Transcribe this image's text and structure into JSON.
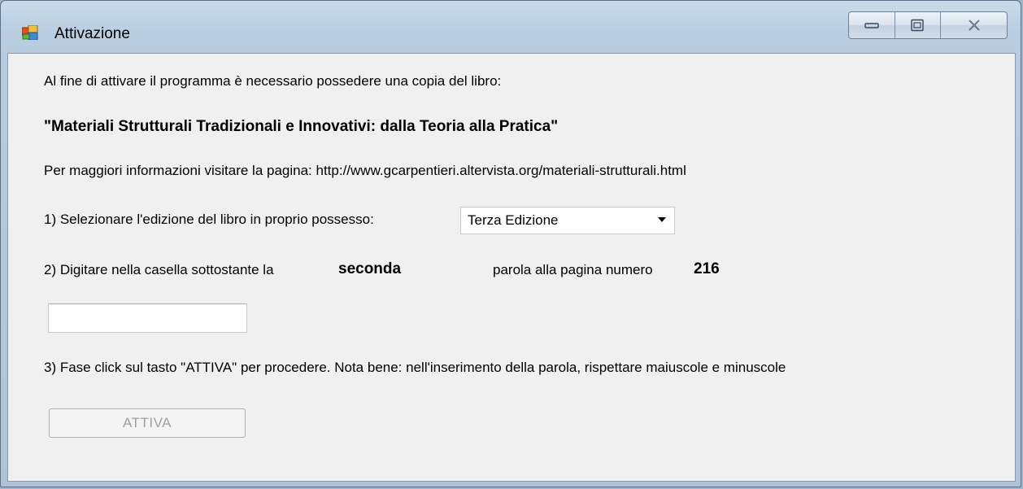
{
  "window": {
    "title": "Attivazione"
  },
  "controls": {
    "minimize_icon": "minimize-icon",
    "maximize_icon": "maximize-icon",
    "close_icon": "close-icon"
  },
  "content": {
    "intro": "Al fine di attivare il programma è necessario possedere una copia del libro:",
    "book_title": "\"Materiali Strutturali Tradizionali e Innovativi: dalla Teoria alla Pratica\"",
    "info": "Per maggiori informazioni visitare la pagina: http://www.gcarpentieri.altervista.org/materiali-strutturali.html",
    "step1_label": "1) Selezionare l'edizione del libro in proprio possesso:",
    "edition_selected": "Terza Edizione",
    "step2_prefix": "2) Digitare nella casella sottostante la",
    "step2_word_ordinal": "seconda",
    "step2_middle": "parola alla pagina numero",
    "step2_page_number": "216",
    "word_input_value": "",
    "step3": "3) Fase click sul tasto \"ATTIVA\" per procedere.  Nota bene: nell'inserimento della parola, rispettare maiuscole e minuscole",
    "activate_button": "ATTIVA"
  },
  "colors": {
    "client_background": "#f0f0f0",
    "disabled_text": "#a0a0a0"
  }
}
